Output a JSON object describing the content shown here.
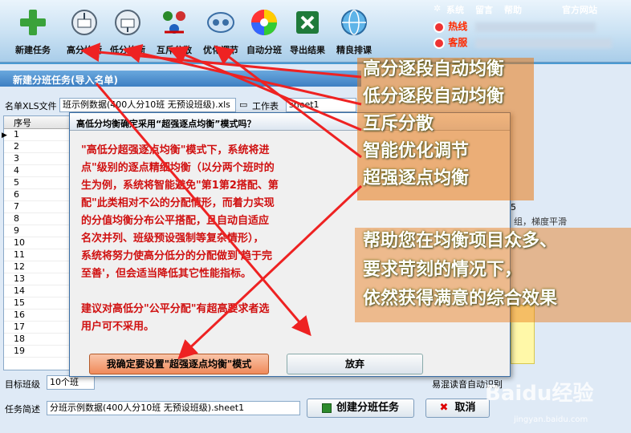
{
  "toolbar": {
    "buttons": [
      {
        "label": "新建任务",
        "icon": "plus-icon"
      },
      {
        "label": "高分均衡",
        "icon": "balance-high-icon"
      },
      {
        "label": "低分均衡",
        "icon": "balance-low-icon"
      },
      {
        "label": "互斥分散",
        "icon": "disperse-icon"
      },
      {
        "label": "优化调节",
        "icon": "optimize-icon"
      },
      {
        "label": "自动分班",
        "icon": "color-wheel-icon"
      },
      {
        "label": "导出结果",
        "icon": "excel-icon"
      },
      {
        "label": "精良排课",
        "icon": "globe-icon"
      }
    ],
    "links": {
      "system": "系统",
      "message": "留言",
      "help": "帮助",
      "website": "官方网站"
    },
    "hotline_label": "热线",
    "service_label": "客服"
  },
  "window": {
    "title": "新建分班任务(导入名单)",
    "xls_label": "名单XLS文件",
    "xls_value": "班示例数据(400人分10班 无预设班级).xls",
    "sheet_label": "工作表",
    "sheet_value": "sheet1",
    "grid_header": "序号",
    "rows": [
      "1",
      "2",
      "3",
      "4",
      "5",
      "6",
      "7",
      "8",
      "9",
      "10",
      "11",
      "12",
      "13",
      "14",
      "15",
      "16",
      "17",
      "18",
      "19"
    ],
    "side_number": "5",
    "side_note": "组，梯度平滑",
    "target_label": "目标班级",
    "target_value": "10个班",
    "right_hint": "易混读音自动识别",
    "task_label": "任务简述",
    "task_value": "分班示例数据(400人分10班 无预设班级).sheet1",
    "create_button": "创建分班任务",
    "cancel_button": "取消"
  },
  "dialog": {
    "title": "高低分均衡确定采用“超强逐点均衡”模式吗？",
    "lines": [
      "\"高低分超强逐点均衡\"模式下，系统将进",
      "点\"级别的逐点精细均衡（以分两个班时的",
      "生为例，系统将智能避免\"第1第2搭配、第",
      "配\"此类相对不公的分配情形，而着力实现",
      "的分值均衡分布公平搭配，且自动自适应",
      "名次并列、班级预设强制等复杂情形），",
      "系统将努力使高分低分的分配做到'趋于完",
      "至善'，但会适当降低其它性能指标。",
      "",
      "建议对高低分\"公平分配\"有超高要求者选",
      "用户可不采用。"
    ],
    "ok_button": "我确定要设置\"超强逐点均衡\"模式",
    "cancel_button": "放弃"
  },
  "callout": {
    "lines": [
      "高分逐段自动均衡",
      "低分逐段自动均衡",
      "互斥分散",
      "智能优化调节",
      "超强逐点均衡",
      "帮助您在均衡项目众多、",
      "要求苛刻的情况下，",
      "依然获得满意的综合效果"
    ]
  },
  "watermark": {
    "text": "Baidu经验",
    "sub": "jingyan.baidu.com"
  },
  "colors": {
    "dialog_text": "#d01010",
    "ok_button": "#f08a5a",
    "callout_bg": "#e87814"
  }
}
